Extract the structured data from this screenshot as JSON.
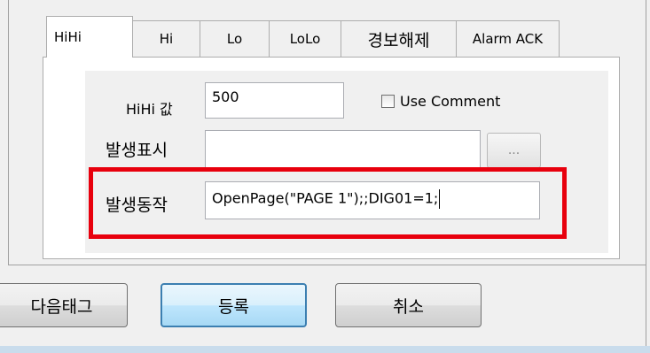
{
  "tabs": [
    {
      "label": "HiHi",
      "active": true
    },
    {
      "label": "Hi"
    },
    {
      "label": "Lo"
    },
    {
      "label": "LoLo"
    },
    {
      "label": "경보해제"
    },
    {
      "label": "Alarm ACK"
    }
  ],
  "form": {
    "hihi_value_label": "HiHi 값",
    "hihi_value": "500",
    "use_comment_label": "Use Comment",
    "use_comment_checked": false,
    "display_label": "발생표시",
    "display_value": "",
    "browse_label": "...",
    "action_label": "발생동작",
    "action_value": "OpenPage(\"PAGE 1\");;DIG01=1;"
  },
  "buttons": {
    "next_tag": "다음태그",
    "register": "등록",
    "cancel": "취소"
  },
  "colors": {
    "highlight": "#e8000d",
    "default_button_border": "#3c7fb1"
  }
}
